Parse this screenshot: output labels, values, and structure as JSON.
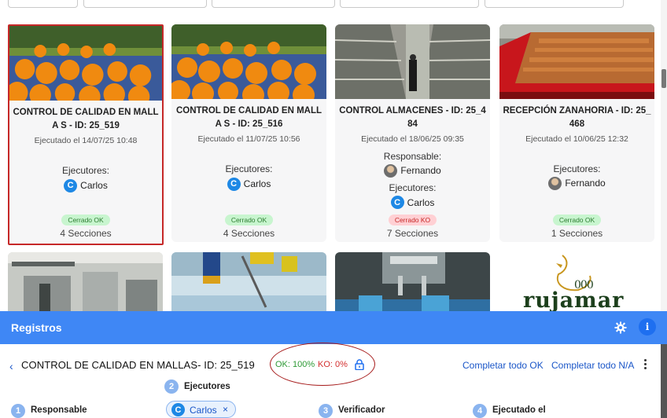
{
  "cards": [
    {
      "title": "CONTROL DE CALIDAD EN MALLA S - ID: 25_519",
      "date": "Ejecutado el 14/07/25 10:48",
      "executors_label": "Ejecutores:",
      "executor": "Carlos",
      "executor_initial": "C",
      "status": "Cerrado OK",
      "sections": "4 Secciones"
    },
    {
      "title": "CONTROL DE CALIDAD EN MALLA S - ID: 25_516",
      "date": "Ejecutado el 11/07/25 10:56",
      "executors_label": "Ejecutores:",
      "executor": "Carlos",
      "executor_initial": "C",
      "status": "Cerrado OK",
      "sections": "4 Secciones"
    },
    {
      "title": "CONTROL ALMACENES - ID: 25_4 84",
      "date": "Ejecutado el 18/06/25 09:35",
      "responsible_label": "Responsable:",
      "responsible": "Fernando",
      "executors_label": "Ejecutores:",
      "executor": "Carlos",
      "executor_initial": "C",
      "status": "Cerrado KO",
      "sections": "7 Secciones"
    },
    {
      "title": "RECEPCIÓN ZANAHORIA - ID: 25_ 468",
      "date": "Ejecutado el 10/06/25 12:32",
      "executors_label": "Ejecutores:",
      "executor": "Fernando",
      "status": "Cerrado OK",
      "sections": "1 Secciones"
    }
  ],
  "logo_text": "rujamar",
  "logo_small": "000",
  "panel": {
    "title": "Registros",
    "info_label": "i",
    "back_icon": "chevron-left-icon",
    "detail_title": "CONTROL DE CALIDAD EN MALLAS- ID: 25_519",
    "ok_percent": "OK: 100%",
    "ko_percent": "KO: 0%",
    "complete_ok": "Completar todo OK",
    "complete_na": "Completar todo N/A"
  },
  "steps": [
    {
      "num": "1",
      "label": "Responsable"
    },
    {
      "num": "2",
      "label": "Ejecutores"
    },
    {
      "num": "3",
      "label": "Verificador"
    },
    {
      "num": "4",
      "label": "Ejecutado el"
    }
  ],
  "executor_chip": {
    "initial": "C",
    "name": "Carlos",
    "remove": "×"
  },
  "colors": {
    "accent": "#3f87f5",
    "ok": "#2e9a36",
    "ko": "#d32f2f",
    "selected_border": "#c62828"
  }
}
